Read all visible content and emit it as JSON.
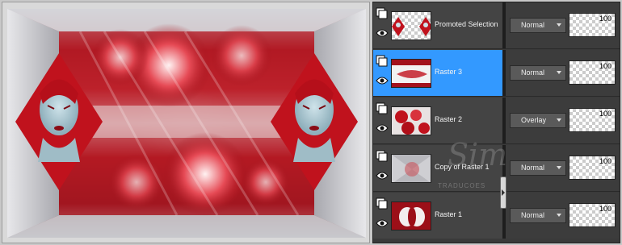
{
  "layers": [
    {
      "name": "Promoted Selection",
      "blend_mode": "Normal",
      "opacity": "100",
      "selected": false,
      "thumb": "faces-on-transparent"
    },
    {
      "name": "Raster 3",
      "blend_mode": "Normal",
      "opacity": "100",
      "selected": true,
      "thumb": "red-white-frame"
    },
    {
      "name": "Raster 2",
      "blend_mode": "Overlay",
      "opacity": "100",
      "selected": false,
      "thumb": "red-flowers"
    },
    {
      "name": "Copy of Raster 1",
      "blend_mode": "Normal",
      "opacity": "100",
      "selected": false,
      "thumb": "grey-radial"
    },
    {
      "name": "Raster 1",
      "blend_mode": "Normal",
      "opacity": "100",
      "selected": false,
      "thumb": "red-radial"
    }
  ],
  "watermark": {
    "signature": "Sim",
    "text": "TRADUCOES"
  },
  "colors": {
    "panel_bg": "#3a3a3a",
    "selected_row": "#3399ff",
    "accent_red": "#b3141f"
  },
  "icons": {
    "layer_type": "stacked-layers-icon",
    "visibility": "eye-icon",
    "dropdown": "chevron-down-icon"
  }
}
